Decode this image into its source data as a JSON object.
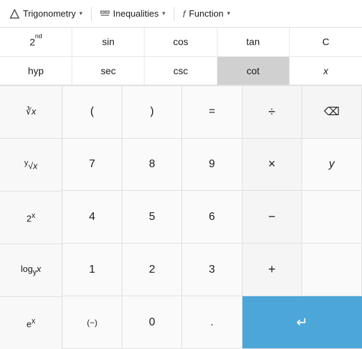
{
  "menu": {
    "trigonometry": "Trigonometry",
    "inequalities": "Inequalities",
    "function": "Function"
  },
  "trig_panel": {
    "row1": [
      {
        "label": "2",
        "sup": "nd",
        "id": "2nd"
      },
      {
        "label": "sin",
        "id": "sin"
      },
      {
        "label": "cos",
        "id": "cos"
      },
      {
        "label": "tan",
        "id": "tan"
      },
      {
        "label": "C",
        "id": "C"
      }
    ],
    "row2": [
      {
        "label": "hyp",
        "id": "hyp"
      },
      {
        "label": "sec",
        "id": "sec"
      },
      {
        "label": "csc",
        "id": "csc"
      },
      {
        "label": "cot",
        "id": "cot",
        "active": true
      },
      {
        "label": "x",
        "id": "x_var"
      }
    ]
  },
  "func_col": [
    {
      "label": "∛x",
      "id": "cube-root",
      "html": "∛x"
    },
    {
      "label": "ʸ√x",
      "id": "nth-root",
      "html": "ʸ√x"
    },
    {
      "label": "2ˣ",
      "id": "power-2",
      "html": "2ˣ"
    },
    {
      "label": "logᵧx",
      "id": "log-base",
      "html": "log<sub>y</sub>x"
    },
    {
      "label": "eˣ",
      "id": "exp-e",
      "html": "eˣ"
    }
  ],
  "main_grid": [
    {
      "label": "(",
      "id": "open-paren",
      "type": "normal"
    },
    {
      "label": ")",
      "id": "close-paren",
      "type": "normal"
    },
    {
      "label": "=",
      "id": "equals",
      "type": "normal"
    },
    {
      "label": "÷",
      "id": "divide",
      "type": "operator"
    },
    {
      "label": "⌫",
      "id": "backspace",
      "type": "operator"
    },
    {
      "label": "7",
      "id": "seven",
      "type": "number"
    },
    {
      "label": "8",
      "id": "eight",
      "type": "number"
    },
    {
      "label": "9",
      "id": "nine",
      "type": "number"
    },
    {
      "label": "×",
      "id": "multiply",
      "type": "operator"
    },
    {
      "label": "y",
      "id": "y-var",
      "type": "normal"
    },
    {
      "label": "4",
      "id": "four",
      "type": "number"
    },
    {
      "label": "5",
      "id": "five",
      "type": "number"
    },
    {
      "label": "6",
      "id": "six",
      "type": "number"
    },
    {
      "label": "−",
      "id": "subtract",
      "type": "operator"
    },
    {
      "label": "",
      "id": "empty1",
      "type": "normal"
    },
    {
      "label": "1",
      "id": "one",
      "type": "number"
    },
    {
      "label": "2",
      "id": "two",
      "type": "number"
    },
    {
      "label": "3",
      "id": "three",
      "type": "number"
    },
    {
      "label": "+",
      "id": "add",
      "type": "operator"
    },
    {
      "label": "",
      "id": "empty2",
      "type": "normal"
    },
    {
      "label": "(−)",
      "id": "negate",
      "type": "normal"
    },
    {
      "label": "0",
      "id": "zero",
      "type": "number"
    },
    {
      "label": ".",
      "id": "decimal",
      "type": "normal"
    },
    {
      "label": "←",
      "id": "enter",
      "type": "enter"
    }
  ],
  "colors": {
    "accent_blue": "#4da6d8",
    "background": "#f0f0f0",
    "button_bg": "#fafafa",
    "operator_bg": "#f5f5f5",
    "border": "#e0e0e0"
  }
}
